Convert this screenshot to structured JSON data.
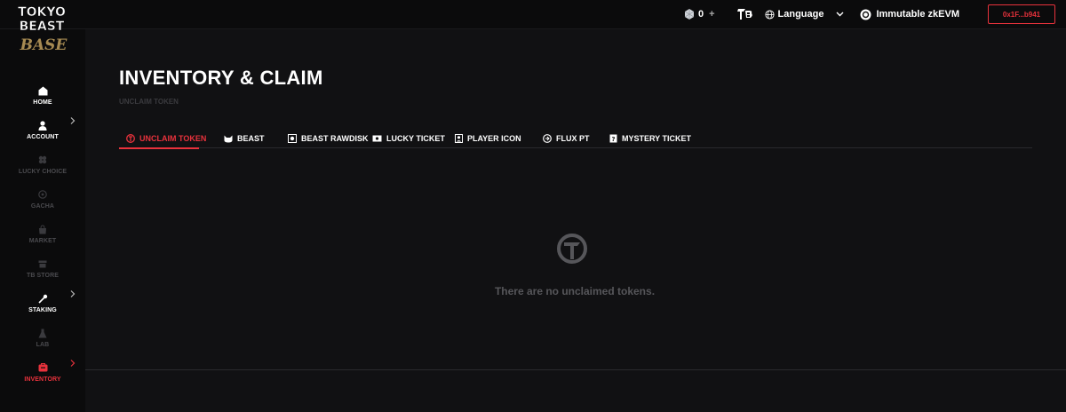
{
  "brand": {
    "logo_text_1": "TOKYO",
    "logo_text_2": "BEAST",
    "logo_text_3": "BASE"
  },
  "topbar": {
    "balance": "0",
    "plus": "+",
    "language_label": "Language",
    "network_label": "Immutable zkEVM",
    "wallet_label": "0x1F...b941"
  },
  "sidebar": {
    "items": [
      {
        "label": "HOME",
        "icon": "home-icon",
        "state": "active"
      },
      {
        "label": "ACCOUNT",
        "icon": "user-icon",
        "state": "active"
      },
      {
        "label": "LUCKY CHOICE",
        "icon": "clover-icon",
        "state": "dim"
      },
      {
        "label": "GACHA",
        "icon": "gacha-icon",
        "state": "dim"
      },
      {
        "label": "MARKET",
        "icon": "bag-icon",
        "state": "dim"
      },
      {
        "label": "TB STORE",
        "icon": "store-icon",
        "state": "dim"
      },
      {
        "label": "STAKING",
        "icon": "staking-icon",
        "state": "active"
      },
      {
        "label": "LAB",
        "icon": "flask-icon",
        "state": "dim"
      },
      {
        "label": "INVENTORY",
        "icon": "inventory-icon",
        "state": "selected"
      }
    ]
  },
  "page": {
    "title": "INVENTORY & CLAIM",
    "subtitle": "UNCLAIM TOKEN"
  },
  "tabs": [
    {
      "label": "UNCLAIM TOKEN",
      "icon": "token-icon"
    },
    {
      "label": "BEAST",
      "icon": "beast-icon"
    },
    {
      "label": "BEAST RAWDISK",
      "icon": "rawdisk-icon"
    },
    {
      "label": "LUCKY TICKET",
      "icon": "ticket-icon"
    },
    {
      "label": "PLAYER ICON",
      "icon": "player-icon"
    },
    {
      "label": "FLUX PT",
      "icon": "flux-icon"
    },
    {
      "label": "MYSTERY TICKET",
      "icon": "mystery-icon"
    }
  ],
  "empty_state": {
    "message": "There are no unclaimed tokens.",
    "icon": "token-logo-icon"
  },
  "colors": {
    "accent": "#e8323c",
    "background": "#111113",
    "sidebar": "#0b0b0c",
    "muted": "#56565a"
  }
}
